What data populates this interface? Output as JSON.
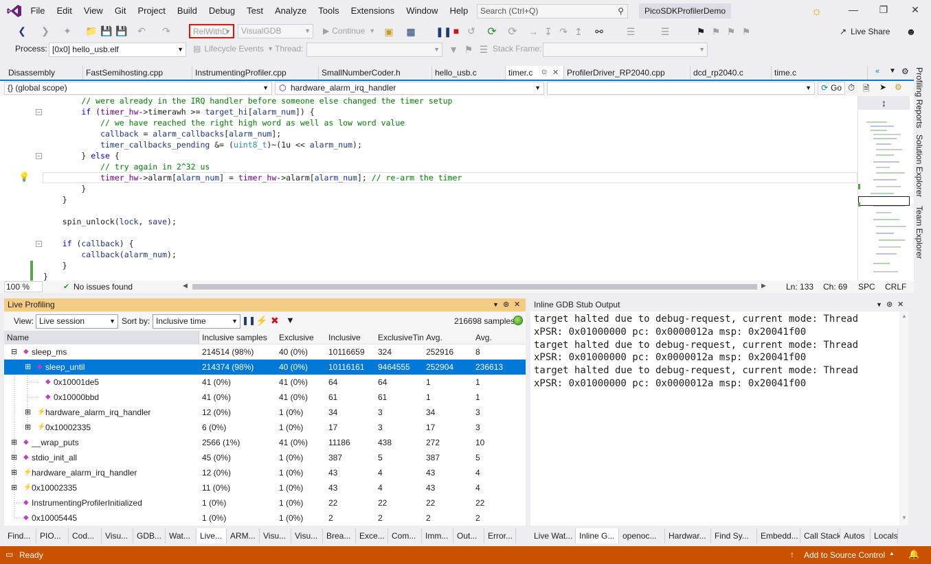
{
  "menubar": {
    "items": [
      "File",
      "Edit",
      "View",
      "Git",
      "Project",
      "Build",
      "Debug",
      "Test",
      "Analyze",
      "Tools",
      "Extensions",
      "Window",
      "Help"
    ],
    "search_placeholder": "Search (Ctrl+Q)",
    "solution_name": "PicoSDKProfilerDemo"
  },
  "toolbar": {
    "config": "RelWithD",
    "platform": "VisualGDB",
    "continue_label": "Continue",
    "live_share": "Live Share",
    "process_label": "Process:",
    "process_value": "[0x0] hello_usb.elf",
    "lifecycle_label": "Lifecycle Events",
    "thread_label": "Thread:",
    "stack_frame_label": "Stack Frame:"
  },
  "doc_tabs": [
    "Disassembly",
    "FastSemihosting.cpp",
    "InstrumentingProfiler.cpp",
    "SmallNumberCoder.h",
    "hello_usb.c",
    "timer.c",
    "ProfilerDriver_RP2040.cpp",
    "dcd_rp2040.c",
    "time.c"
  ],
  "side_tabs": [
    "Profiling Reports",
    "Solution Explorer",
    "Team Explorer"
  ],
  "navbar": {
    "scope": "{} (global scope)",
    "function": "hardware_alarm_irq_handler",
    "go_label": "Go"
  },
  "editor": {
    "status": {
      "zoom": "100 %",
      "issues": "No issues found",
      "line": "Ln: 133",
      "col": "Ch: 69",
      "spc": "SPC",
      "eol": "CRLF"
    }
  },
  "live_profiling": {
    "title": "Live Profiling",
    "view_label": "View:",
    "view_value": "Live session",
    "sort_label": "Sort by:",
    "sort_value": "Inclusive time",
    "samples": "216698 samples",
    "columns": [
      "Name",
      "Inclusive samples",
      "Exclusive",
      "Inclusive",
      "ExclusiveTin",
      "Avg.",
      "Avg."
    ],
    "rows": [
      {
        "name": "sleep_ms",
        "c1": "214514 (98%)",
        "c2": "40 (0%)",
        "c3": "10116659",
        "c4": "324",
        "c5": "252916",
        "c6": "8"
      },
      {
        "name": "sleep_until",
        "c1": "214374 (98%)",
        "c2": "40 (0%)",
        "c3": "10116161",
        "c4": "9464555",
        "c5": "252904",
        "c6": "236613"
      },
      {
        "name": "0x10001de5",
        "c1": "41 (0%)",
        "c2": "41 (0%)",
        "c3": "64",
        "c4": "64",
        "c5": "1",
        "c6": "1"
      },
      {
        "name": "0x10000bbd",
        "c1": "41 (0%)",
        "c2": "41 (0%)",
        "c3": "61",
        "c4": "61",
        "c5": "1",
        "c6": "1"
      },
      {
        "name": "hardware_alarm_irq_handler",
        "c1": "12 (0%)",
        "c2": "1 (0%)",
        "c3": "34",
        "c4": "3",
        "c5": "34",
        "c6": "3"
      },
      {
        "name": "0x10002335",
        "c1": "6 (0%)",
        "c2": "1 (0%)",
        "c3": "17",
        "c4": "3",
        "c5": "17",
        "c6": "3"
      },
      {
        "name": "__wrap_puts",
        "c1": "2566 (1%)",
        "c2": "41 (0%)",
        "c3": "11186",
        "c4": "438",
        "c5": "272",
        "c6": "10"
      },
      {
        "name": "stdio_init_all",
        "c1": "45 (0%)",
        "c2": "1 (0%)",
        "c3": "387",
        "c4": "5",
        "c5": "387",
        "c6": "5"
      },
      {
        "name": "hardware_alarm_irq_handler",
        "c1": "12 (0%)",
        "c2": "1 (0%)",
        "c3": "43",
        "c4": "4",
        "c5": "43",
        "c6": "4"
      },
      {
        "name": "0x10002335",
        "c1": "11 (0%)",
        "c2": "1 (0%)",
        "c3": "43",
        "c4": "4",
        "c5": "43",
        "c6": "4"
      },
      {
        "name": "InstrumentingProfilerInitialized",
        "c1": "1 (0%)",
        "c2": "1 (0%)",
        "c3": "22",
        "c4": "22",
        "c5": "22",
        "c6": "22"
      },
      {
        "name": "0x10005445",
        "c1": "1 (0%)",
        "c2": "1 (0%)",
        "c3": "2",
        "c4": "2",
        "c5": "2",
        "c6": "2"
      }
    ]
  },
  "gdb": {
    "title": "Inline GDB Stub Output",
    "text": "target halted due to debug-request, current mode: Thread\nxPSR: 0x01000000 pc: 0x0000012a msp: 0x20041f00\ntarget halted due to debug-request, current mode: Thread\nxPSR: 0x01000000 pc: 0x0000012a msp: 0x20041f00\ntarget halted due to debug-request, current mode: Thread\nxPSR: 0x01000000 pc: 0x0000012a msp: 0x20041f00"
  },
  "bottom_tabs_left": [
    "Find...",
    "PIO...",
    "Cod...",
    "Visu...",
    "GDB...",
    "Wat...",
    "Live...",
    "ARM...",
    "Visu...",
    "Visu...",
    "Brea...",
    "Exce...",
    "Com...",
    "Imm...",
    "Out...",
    "Error..."
  ],
  "bottom_tabs_right": [
    "Live Wat...",
    "Inline G...",
    "openoc...",
    "Hardwar...",
    "Find Sy...",
    "Embedd...",
    "Call Stack",
    "Autos",
    "Locals"
  ],
  "statusbar": {
    "ready": "Ready",
    "source_control": "Add to Source Control"
  },
  "colors": {
    "accent": "#007ACC",
    "statusbar": "#CA5100",
    "panel_active": "#F5CC84",
    "selection": "#0078D7"
  }
}
